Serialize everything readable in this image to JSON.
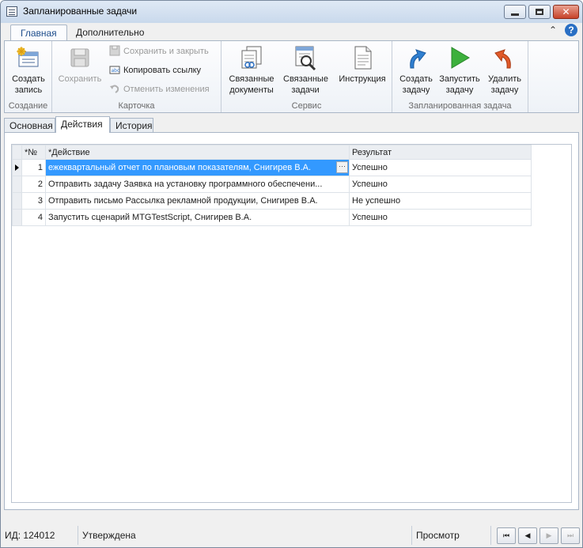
{
  "window": {
    "title": "Запланированные задачи"
  },
  "ribbon_tabs": [
    "Главная",
    "Дополнительно"
  ],
  "ribbon": {
    "groups": {
      "creation": {
        "label": "Создание",
        "create_record": "Создать запись"
      },
      "card": {
        "label": "Карточка",
        "save": "Сохранить",
        "save_and_close": "Сохранить и закрыть",
        "copy_link": "Копировать ссылку",
        "cancel_changes": "Отменить изменения"
      },
      "service": {
        "label": "Сервис",
        "related_documents": "Связанные документы",
        "related_tasks": "Связанные задачи",
        "instruction": "Инструкция"
      },
      "scheduled_task": {
        "label": "Запланированная задача",
        "create_task": "Создать задачу",
        "start_task": "Запустить задачу",
        "delete_task": "Удалить задачу"
      }
    }
  },
  "form_tabs": [
    "Основная",
    "Действия",
    "История"
  ],
  "grid": {
    "columns": {
      "num": "*№",
      "action": "*Действие",
      "result": "Результат"
    },
    "rows": [
      {
        "num": "1",
        "action": "ежеквартальный отчет по плановым показателям, Снигирев В.А.",
        "result": "Успешно"
      },
      {
        "num": "2",
        "action": "Отправить задачу Заявка на установку программного обеспечени...",
        "result": "Успешно"
      },
      {
        "num": "3",
        "action": "Отправить письмо Рассылка рекламной продукции, Снигирев В.А.",
        "result": "Не успешно"
      },
      {
        "num": "4",
        "action": "Запустить сценарий MTGTestScript, Снигирев В.А.",
        "result": "Успешно"
      }
    ],
    "ellipsis": "···"
  },
  "statusbar": {
    "id": "ИД: 124012",
    "state": "Утверждена",
    "mode": "Просмотр"
  },
  "colors": {
    "accent": "#1f4e8c",
    "selection": "#3399ff",
    "start_green": "#3cb03c",
    "create_blue": "#2f7fd0",
    "delete_red": "#e05a2a"
  }
}
